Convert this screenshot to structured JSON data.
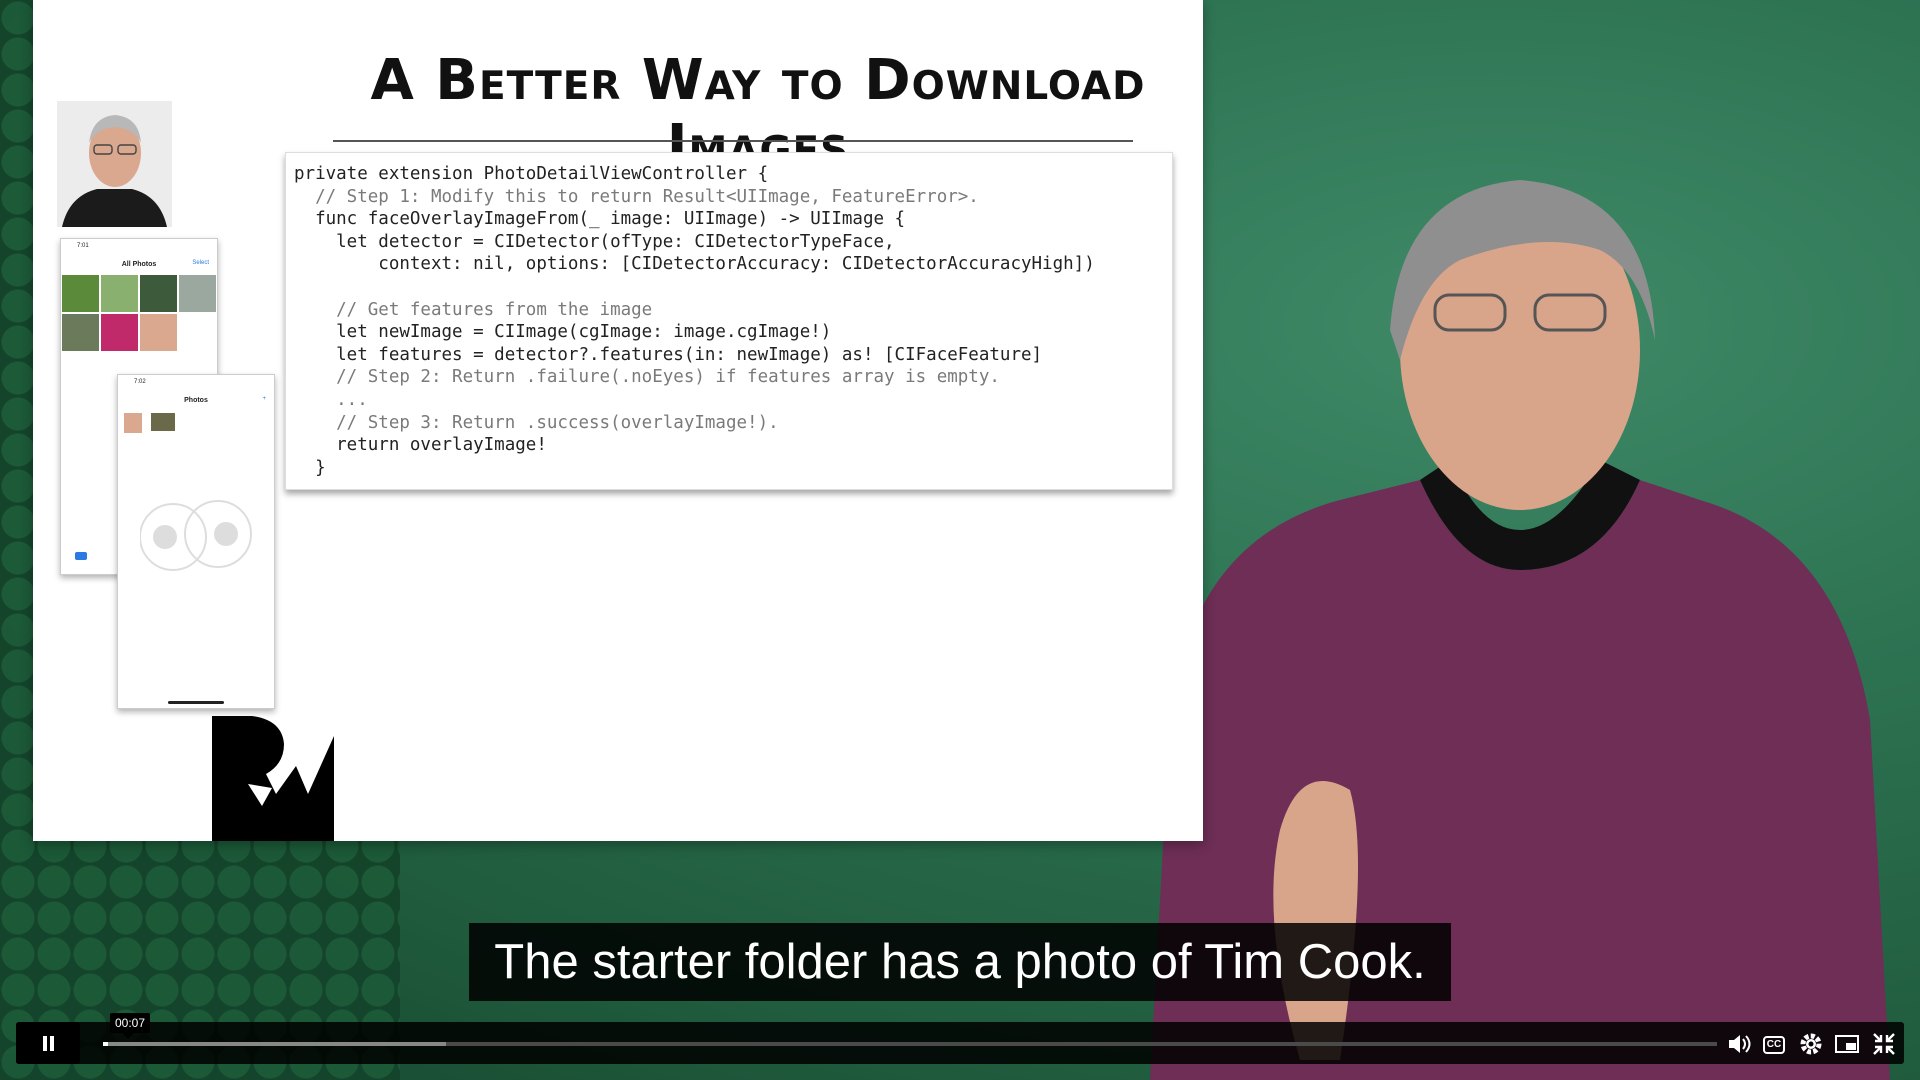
{
  "slide": {
    "title": "A Better Way to Download Images",
    "code_lines": [
      "private extension PhotoDetailViewController {",
      "  // Step 1: Modify this to return Result<UIImage, FeatureError>.",
      "  func faceOverlayImageFrom(_ image: UIImage) -> UIImage {",
      "    let detector = CIDetector(ofType: CIDetectorTypeFace,",
      "        context: nil, options: [CIDetectorAccuracy: CIDetectorAccuracyHigh])",
      "",
      "    // Get features from the image",
      "    let newImage = CIImage(cgImage: image.cgImage!)",
      "    let features = detector?.features(in: newImage) as! [CIFaceFeature]",
      "    // Step 2: Return .failure(.noEyes) if features array is empty.",
      "    ...",
      "    // Step 3: Return .success(overlayImage!).",
      "    return overlayImage!",
      "  }"
    ],
    "phone1": {
      "time": "7:01",
      "title": "All Photos",
      "action": "Select",
      "tab": "All Photos"
    },
    "phone2": {
      "time": "7:02",
      "title": "Photos",
      "action": "+"
    }
  },
  "caption": "The starter folder has a photo of Tim Cook.",
  "player": {
    "current_time": "00:07",
    "progress_fraction": 0.003,
    "buffered_fraction": 0.21,
    "icons": [
      "pause-icon",
      "volume-icon",
      "captions-icon",
      "settings-icon",
      "pip-icon",
      "exit-fullscreen-icon"
    ]
  },
  "colors": {
    "background_green": "#2d7352",
    "keyword": "#a6306b",
    "type": "#2a5ba7",
    "comment": "#7a7a7a"
  }
}
